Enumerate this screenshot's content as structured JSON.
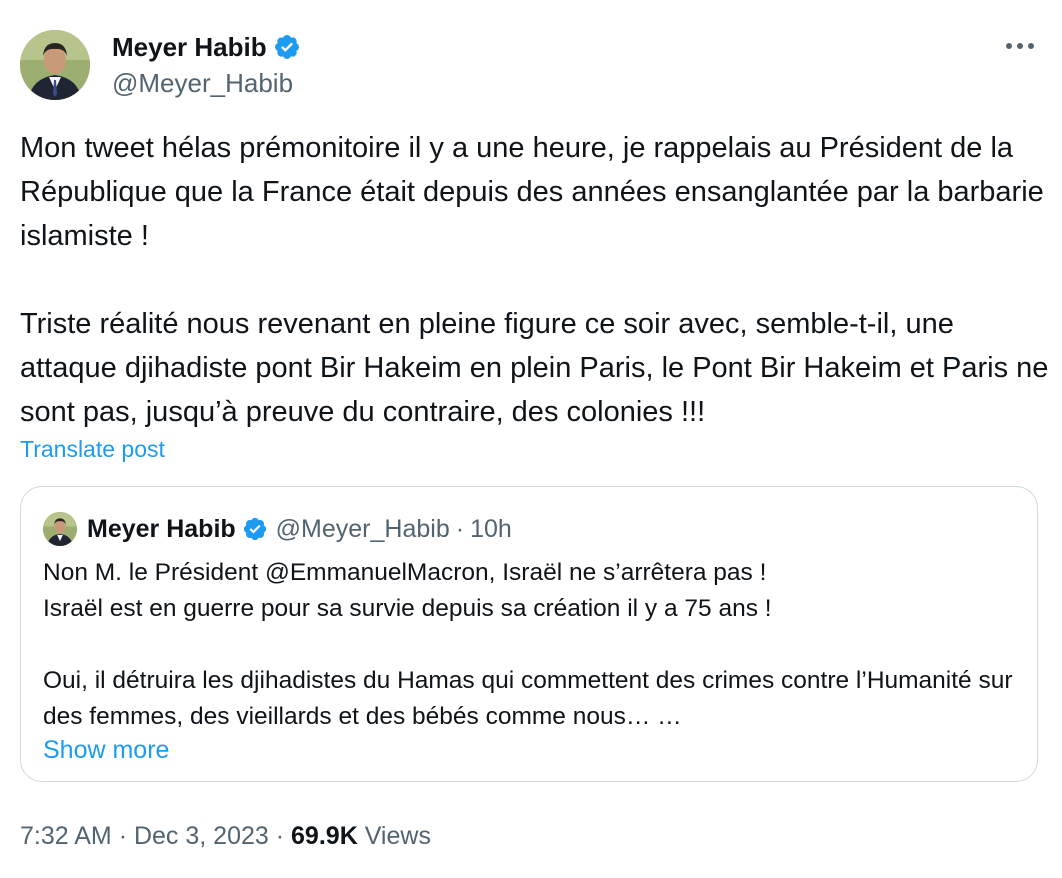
{
  "author": {
    "name": "Meyer Habib",
    "handle": "@Meyer_Habib",
    "verified_color": "#1d9bf0"
  },
  "tweet": {
    "text": "Mon tweet hélas prémonitoire il y a une heure, je rappelais au Président de la République que la France était depuis des années ensanglantée par la barbarie islamiste !\n\nTriste réalité nous revenant en pleine figure ce soir avec, semble-t-il, une attaque djihadiste pont Bir Hakeim en plein Paris, le Pont Bir Hakeim et Paris ne sont pas, jusqu’à preuve du contraire, des colonies !!!",
    "translate_label": "Translate post"
  },
  "quote": {
    "name": "Meyer Habib",
    "handle": "@Meyer_Habib",
    "separator": "·",
    "time": "10h",
    "text": "Non M. le Président @EmmanuelMacron, Israël ne s’arrêtera pas !\nIsraël est en guerre pour sa survie depuis sa création il y a 75 ans !\n\nOui, il détruira les djihadistes du Hamas qui commettent des crimes contre l’Humanité sur des femmes, des vieillards et des bébés comme nous… …",
    "show_more_label": "Show more"
  },
  "meta": {
    "time": "7:32 AM",
    "separator": "·",
    "date": "Dec 3, 2023",
    "views_count": "69.9K",
    "views_label": "Views"
  },
  "icons": {
    "more": "more-horizontal-icon",
    "verified": "verified-badge-icon"
  },
  "colors": {
    "text": "#0f1419",
    "secondary": "#536471",
    "link": "#1d9bf0",
    "border": "#cfd9de"
  }
}
